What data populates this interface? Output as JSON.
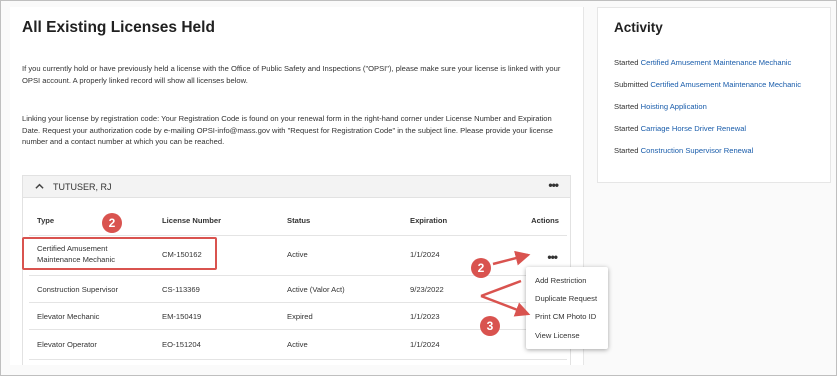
{
  "left": {
    "title": "All Existing Licenses Held",
    "para1": "If you currently hold or have previously held a license with the Office of Public Safety and Inspections (\"OPSI\"), please make sure your license is linked with your OPSI account. A properly linked record will show all licenses below.",
    "para2": "Linking your license by registration code: Your Registration Code is found on your renewal form in the right-hand corner under License Number and Expiration Date. Request your authorization code by e-mailing OPSI-info@mass.gov with \"Request for Registration Code\" in the subject line. Please provide your license number and a contact number at which you can be reached.",
    "holder_name": "TUTUSER, RJ",
    "more_icon": "•••"
  },
  "table": {
    "headers": {
      "type": "Type",
      "number": "License Number",
      "status": "Status",
      "expiration": "Expiration",
      "actions": "Actions"
    },
    "rows": [
      {
        "type": "Certified Amusement Maintenance Mechanic",
        "number": "CM-150162",
        "status": "Active",
        "expiration": "1/1/2024",
        "actions": "•••"
      },
      {
        "type": "Construction Supervisor",
        "number": "CS-113369",
        "status": "Active (Valor Act)",
        "expiration": "9/23/2022"
      },
      {
        "type": "Elevator Mechanic",
        "number": "EM-150419",
        "status": "Expired",
        "expiration": "1/1/2023"
      },
      {
        "type": "Elevator Operator",
        "number": "EO-151204",
        "status": "Active",
        "expiration": "1/1/2024"
      }
    ]
  },
  "menu": {
    "items": [
      "Add Restriction",
      "Duplicate Request",
      "Print CM Photo ID",
      "View License"
    ]
  },
  "callouts": [
    "2",
    "2",
    "3"
  ],
  "activity": {
    "title": "Activity",
    "items": [
      {
        "verb": "Started",
        "link": "Certified Amusement Maintenance Mechanic"
      },
      {
        "verb": "Submitted",
        "link": "Certified Amusement Maintenance Mechanic"
      },
      {
        "verb": "Started",
        "link": "Hoisting Application"
      },
      {
        "verb": "Started",
        "link": "Carriage Horse Driver Renewal"
      },
      {
        "verb": "Started",
        "link": "Construction Supervisor Renewal"
      }
    ]
  },
  "colors": {
    "accent_red": "#d9534f",
    "link_blue": "#1a5dab"
  }
}
